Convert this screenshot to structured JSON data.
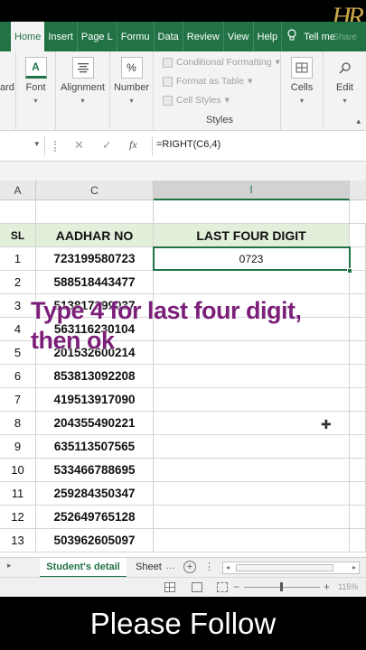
{
  "ribbon_tabs": [
    "Home",
    "Insert",
    "Page L",
    "Formu",
    "Data",
    "Review",
    "View",
    "Help"
  ],
  "tell_me": "Tell me",
  "share": "Share",
  "logo_text": "HR",
  "ribbon": {
    "clipboard_label": "ard",
    "font_label": "Font",
    "alignment_label": "Alignment",
    "number_label": "Number",
    "number_icon": "%",
    "font_icon": "A",
    "conditional_formatting": "Conditional Formatting",
    "format_as_table": "Format as Table",
    "cell_styles": "Cell Styles",
    "styles_label": "Styles",
    "cells_label": "Cells",
    "editing_label": "Edit"
  },
  "formula_bar": {
    "name_box": "",
    "cancel_icon": "✕",
    "enter_icon": "✓",
    "fx": "fx",
    "formula": "=RIGHT(C6,4)"
  },
  "columns": {
    "a": "A",
    "c": "C",
    "i": "I"
  },
  "table": {
    "headers": {
      "sl": "SL",
      "aadhar": "AADHAR NO",
      "last": "LAST FOUR DIGIT"
    },
    "rows": [
      {
        "sl": "1",
        "aadhar": "723199580723",
        "last": "0723"
      },
      {
        "sl": "2",
        "aadhar": "588518443477",
        "last": ""
      },
      {
        "sl": "3",
        "aadhar": "513817399037",
        "last": ""
      },
      {
        "sl": "4",
        "aadhar": "563116230104",
        "last": ""
      },
      {
        "sl": "5",
        "aadhar": "201532600214",
        "last": ""
      },
      {
        "sl": "6",
        "aadhar": "853813092208",
        "last": ""
      },
      {
        "sl": "7",
        "aadhar": "419513917090",
        "last": ""
      },
      {
        "sl": "8",
        "aadhar": "204355490221",
        "last": ""
      },
      {
        "sl": "9",
        "aadhar": "635113507565",
        "last": ""
      },
      {
        "sl": "10",
        "aadhar": "533466788695",
        "last": ""
      },
      {
        "sl": "11",
        "aadhar": "259284350347",
        "last": ""
      },
      {
        "sl": "12",
        "aadhar": "252649765128",
        "last": ""
      },
      {
        "sl": "13",
        "aadhar": "503962605097",
        "last": ""
      }
    ]
  },
  "overlay_text": "Type 4 for last four digit, then ok",
  "sheets": {
    "active": "Student's detail",
    "other": "Sheet",
    "more": "…"
  },
  "status": {
    "zoom": "115%"
  },
  "footer_text": "Please Follow",
  "colors": {
    "excel_green": "#217346",
    "header_fill": "#e2efda",
    "overlay": "#7b1f78"
  }
}
